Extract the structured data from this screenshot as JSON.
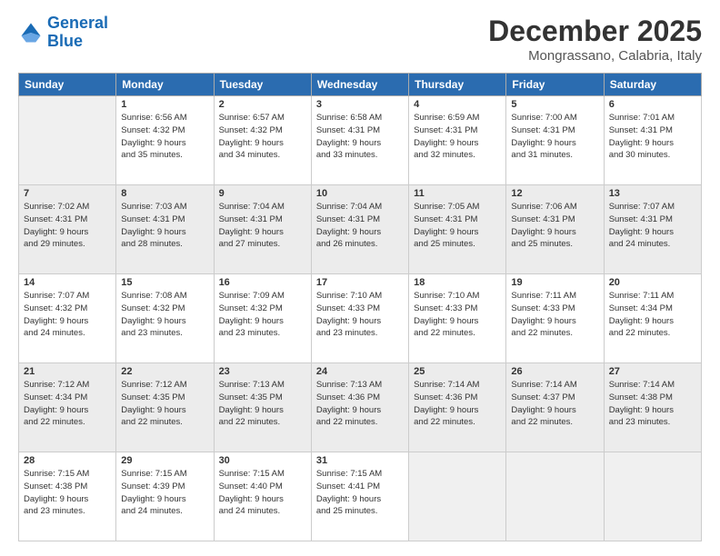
{
  "header": {
    "logo_line1": "General",
    "logo_line2": "Blue",
    "month_title": "December 2025",
    "location": "Mongrassano, Calabria, Italy"
  },
  "days_of_week": [
    "Sunday",
    "Monday",
    "Tuesday",
    "Wednesday",
    "Thursday",
    "Friday",
    "Saturday"
  ],
  "weeks": [
    [
      {
        "day": "",
        "info": ""
      },
      {
        "day": "1",
        "info": "Sunrise: 6:56 AM\nSunset: 4:32 PM\nDaylight: 9 hours\nand 35 minutes."
      },
      {
        "day": "2",
        "info": "Sunrise: 6:57 AM\nSunset: 4:32 PM\nDaylight: 9 hours\nand 34 minutes."
      },
      {
        "day": "3",
        "info": "Sunrise: 6:58 AM\nSunset: 4:31 PM\nDaylight: 9 hours\nand 33 minutes."
      },
      {
        "day": "4",
        "info": "Sunrise: 6:59 AM\nSunset: 4:31 PM\nDaylight: 9 hours\nand 32 minutes."
      },
      {
        "day": "5",
        "info": "Sunrise: 7:00 AM\nSunset: 4:31 PM\nDaylight: 9 hours\nand 31 minutes."
      },
      {
        "day": "6",
        "info": "Sunrise: 7:01 AM\nSunset: 4:31 PM\nDaylight: 9 hours\nand 30 minutes."
      }
    ],
    [
      {
        "day": "7",
        "info": "Sunrise: 7:02 AM\nSunset: 4:31 PM\nDaylight: 9 hours\nand 29 minutes."
      },
      {
        "day": "8",
        "info": "Sunrise: 7:03 AM\nSunset: 4:31 PM\nDaylight: 9 hours\nand 28 minutes."
      },
      {
        "day": "9",
        "info": "Sunrise: 7:04 AM\nSunset: 4:31 PM\nDaylight: 9 hours\nand 27 minutes."
      },
      {
        "day": "10",
        "info": "Sunrise: 7:04 AM\nSunset: 4:31 PM\nDaylight: 9 hours\nand 26 minutes."
      },
      {
        "day": "11",
        "info": "Sunrise: 7:05 AM\nSunset: 4:31 PM\nDaylight: 9 hours\nand 25 minutes."
      },
      {
        "day": "12",
        "info": "Sunrise: 7:06 AM\nSunset: 4:31 PM\nDaylight: 9 hours\nand 25 minutes."
      },
      {
        "day": "13",
        "info": "Sunrise: 7:07 AM\nSunset: 4:31 PM\nDaylight: 9 hours\nand 24 minutes."
      }
    ],
    [
      {
        "day": "14",
        "info": "Sunrise: 7:07 AM\nSunset: 4:32 PM\nDaylight: 9 hours\nand 24 minutes."
      },
      {
        "day": "15",
        "info": "Sunrise: 7:08 AM\nSunset: 4:32 PM\nDaylight: 9 hours\nand 23 minutes."
      },
      {
        "day": "16",
        "info": "Sunrise: 7:09 AM\nSunset: 4:32 PM\nDaylight: 9 hours\nand 23 minutes."
      },
      {
        "day": "17",
        "info": "Sunrise: 7:10 AM\nSunset: 4:33 PM\nDaylight: 9 hours\nand 23 minutes."
      },
      {
        "day": "18",
        "info": "Sunrise: 7:10 AM\nSunset: 4:33 PM\nDaylight: 9 hours\nand 22 minutes."
      },
      {
        "day": "19",
        "info": "Sunrise: 7:11 AM\nSunset: 4:33 PM\nDaylight: 9 hours\nand 22 minutes."
      },
      {
        "day": "20",
        "info": "Sunrise: 7:11 AM\nSunset: 4:34 PM\nDaylight: 9 hours\nand 22 minutes."
      }
    ],
    [
      {
        "day": "21",
        "info": "Sunrise: 7:12 AM\nSunset: 4:34 PM\nDaylight: 9 hours\nand 22 minutes."
      },
      {
        "day": "22",
        "info": "Sunrise: 7:12 AM\nSunset: 4:35 PM\nDaylight: 9 hours\nand 22 minutes."
      },
      {
        "day": "23",
        "info": "Sunrise: 7:13 AM\nSunset: 4:35 PM\nDaylight: 9 hours\nand 22 minutes."
      },
      {
        "day": "24",
        "info": "Sunrise: 7:13 AM\nSunset: 4:36 PM\nDaylight: 9 hours\nand 22 minutes."
      },
      {
        "day": "25",
        "info": "Sunrise: 7:14 AM\nSunset: 4:36 PM\nDaylight: 9 hours\nand 22 minutes."
      },
      {
        "day": "26",
        "info": "Sunrise: 7:14 AM\nSunset: 4:37 PM\nDaylight: 9 hours\nand 22 minutes."
      },
      {
        "day": "27",
        "info": "Sunrise: 7:14 AM\nSunset: 4:38 PM\nDaylight: 9 hours\nand 23 minutes."
      }
    ],
    [
      {
        "day": "28",
        "info": "Sunrise: 7:15 AM\nSunset: 4:38 PM\nDaylight: 9 hours\nand 23 minutes."
      },
      {
        "day": "29",
        "info": "Sunrise: 7:15 AM\nSunset: 4:39 PM\nDaylight: 9 hours\nand 24 minutes."
      },
      {
        "day": "30",
        "info": "Sunrise: 7:15 AM\nSunset: 4:40 PM\nDaylight: 9 hours\nand 24 minutes."
      },
      {
        "day": "31",
        "info": "Sunrise: 7:15 AM\nSunset: 4:41 PM\nDaylight: 9 hours\nand 25 minutes."
      },
      {
        "day": "",
        "info": ""
      },
      {
        "day": "",
        "info": ""
      },
      {
        "day": "",
        "info": ""
      }
    ]
  ]
}
